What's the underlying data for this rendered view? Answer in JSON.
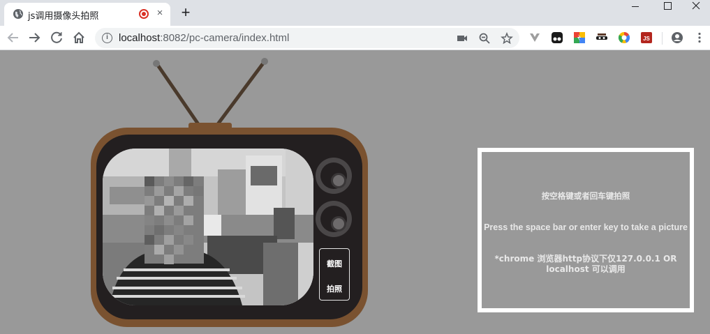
{
  "browser": {
    "tab": {
      "title": "js调用摄像头拍照",
      "favicon": "globe-icon",
      "recording_indicator": "record-icon",
      "close": "×"
    },
    "new_tab_label": "+",
    "url_host": "localhost",
    "url_rest": ":8082/pc-camera/index.html",
    "toolbar_icons": [
      "back-icon",
      "forward-icon",
      "reload-icon",
      "home-icon",
      "info-icon",
      "camera-icon",
      "zoom-icon",
      "star-icon"
    ],
    "extensions": [
      "vue-devtools-icon",
      "tampermonkey-icon",
      "extension-colorful-icon",
      "incognito-mask-icon",
      "chrome-color-icon",
      "js-extension-icon"
    ],
    "profile": "account-icon",
    "menu": "more-vert-icon"
  },
  "camera": {
    "screenshot_label": "截图",
    "photo_label": "拍照"
  },
  "panel": {
    "hint_cn": "按空格键或者回车键拍照",
    "hint_en": "Press the space bar or enter key to take a picture",
    "hint_chrome": "*chrome 浏览器http协议下仅127.0.0.1 OR localhost 可以调用"
  },
  "colors": {
    "background": "#999999",
    "tv_wood": "#7a5230",
    "tv_face": "#231f20",
    "frame": "#ffffff",
    "record": "#d93025"
  }
}
